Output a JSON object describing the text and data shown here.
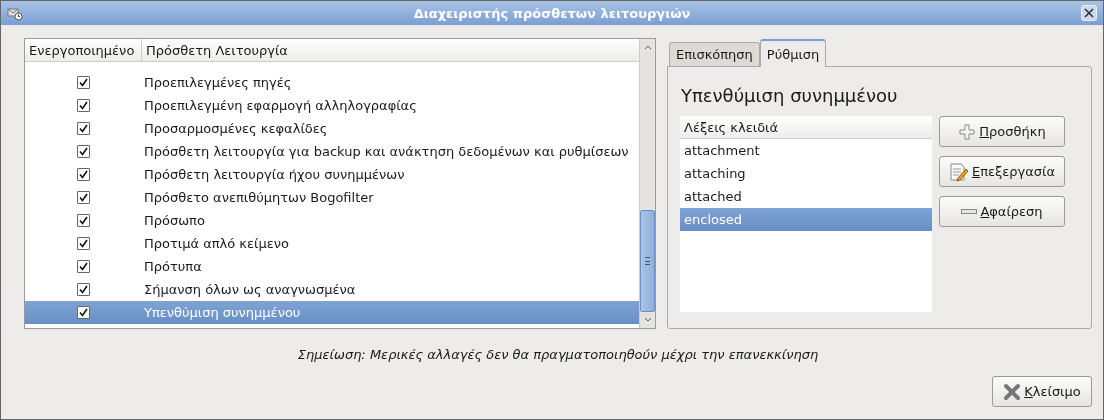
{
  "window": {
    "title": "Διαχειριστής πρόσθετων λειτουργιών"
  },
  "plugins": {
    "columns": [
      "Ενεργοποιημένο",
      "Πρόσθετη Λειτουργία"
    ],
    "rows": [
      {
        "name": "Προεπιλεγμένες πηγές",
        "enabled": true,
        "selected": false
      },
      {
        "name": "Προεπιλεγμένη εφαρμογή αλληλογραφίας",
        "enabled": true,
        "selected": false
      },
      {
        "name": "Προσαρμοσμένες κεφαλίδες",
        "enabled": true,
        "selected": false
      },
      {
        "name": "Πρόσθετη λειτουργία για backup και ανάκτηση δεδομένων και ρυθμίσεων",
        "enabled": true,
        "selected": false
      },
      {
        "name": "Πρόσθετη λειτουργία ήχου συνημμένων",
        "enabled": true,
        "selected": false
      },
      {
        "name": "Πρόσθετο ανεπιθύμητων Bogofilter",
        "enabled": true,
        "selected": false
      },
      {
        "name": "Πρόσωπο",
        "enabled": true,
        "selected": false
      },
      {
        "name": "Προτιμά απλό κείμενο",
        "enabled": true,
        "selected": false
      },
      {
        "name": "Πρότυπα",
        "enabled": true,
        "selected": false
      },
      {
        "name": "Σήμανση όλων ως αναγνωσμένα",
        "enabled": true,
        "selected": false
      },
      {
        "name": "Υπενθύμιση συνημμένου",
        "enabled": true,
        "selected": true
      }
    ]
  },
  "tabs": [
    {
      "label": "Επισκόπηση",
      "selected": false
    },
    {
      "label": "Ρύθμιση",
      "selected": true
    }
  ],
  "settings": {
    "heading": "Υπενθύμιση συνημμένου",
    "keywords_header": "Λέξεις κλειδιά",
    "keywords": [
      {
        "text": "attachment",
        "selected": false
      },
      {
        "text": "attaching",
        "selected": false
      },
      {
        "text": "attached",
        "selected": false
      },
      {
        "text": "enclosed",
        "selected": true
      }
    ],
    "buttons": [
      {
        "kind": "add",
        "label": "Προσθήκη",
        "mnemonic": true
      },
      {
        "kind": "edit",
        "label": "Επεξεργασία",
        "mnemonic": true
      },
      {
        "kind": "remove",
        "label": "Αφαίρεση",
        "mnemonic": true
      }
    ]
  },
  "note": "Σημείωση: Μερικές αλλαγές δεν θα πραγματοποιηθούν μέχρι την επανεκκίνηση",
  "close_button": {
    "label": "Κλείσιμο",
    "mnemonic": true
  }
}
